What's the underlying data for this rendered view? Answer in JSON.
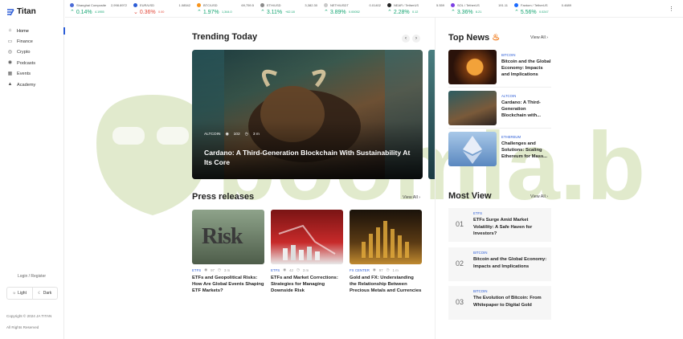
{
  "app": {
    "name": "Titan"
  },
  "sidebar": {
    "items": [
      {
        "label": "Home",
        "icon": "home-icon"
      },
      {
        "label": "Finance",
        "icon": "finance-icon"
      },
      {
        "label": "Crypto",
        "icon": "crypto-icon"
      },
      {
        "label": "Podcasts",
        "icon": "podcast-icon"
      },
      {
        "label": "Events",
        "icon": "calendar-icon"
      },
      {
        "label": "Academy",
        "icon": "academy-icon"
      }
    ],
    "login_label": "Login / Register",
    "theme": {
      "light": "Light",
      "dark": "Dark"
    },
    "copyright": "Copyright © 2024 JA TITAN",
    "rights": "All Rights Reserved"
  },
  "ticker": [
    {
      "name": "Shanghai Composite",
      "price": "2,998.8972",
      "pct": "0.14%",
      "chg": "4.1955",
      "dir": "up",
      "color": "#4b6bd6"
    },
    {
      "name": "EUR/USD",
      "price": "1.08542",
      "pct": "0.36%",
      "chg": "0.00",
      "dir": "down",
      "color": "#2b5cd6"
    },
    {
      "name": "BTC/USD",
      "price": "69,759.5",
      "pct": "1.97%",
      "chg": "1,344.0",
      "dir": "up",
      "color": "#f7931a"
    },
    {
      "name": "ETH/USD",
      "price": "3,382.30",
      "pct": "3.11%",
      "chg": "+62.18",
      "dir": "up",
      "color": "#8a8a8a"
    },
    {
      "name": "NETH/USDT",
      "price": "0.01402",
      "pct": "3.89%",
      "chg": "0.00052",
      "dir": "up",
      "color": "#c9c9c9"
    },
    {
      "name": "NEAR / TetherUS",
      "price": "5.559",
      "pct": "2.28%",
      "chg": "0.12",
      "dir": "up",
      "color": "#222"
    },
    {
      "name": "SOL / TetherUS",
      "price": "191.11",
      "pct": "3.36%",
      "chg": "6.21",
      "dir": "up",
      "color": "#7b3fe4"
    },
    {
      "name": "Fantom / TetherUS",
      "price": "0.4689",
      "pct": "5.56%",
      "chg": "0.0247",
      "dir": "up",
      "color": "#1969ff"
    }
  ],
  "trending": {
    "title": "Trending Today",
    "prev_icon": "chevron-left-icon",
    "next_icon": "chevron-right-icon",
    "hero": {
      "category": "ALTCOIN",
      "views": "102",
      "read_time": "3 m",
      "title": "Cardano: A Third-Generation Blockchain With Sustainability At Its Core"
    }
  },
  "press": {
    "title": "Press releases",
    "view_all": "View All",
    "items": [
      {
        "category": "ETFS",
        "views": "97",
        "read_time": "3 m",
        "title": "ETFs and Geopolitical Risks: How Are Global Events Shaping ETF Markets?",
        "thumb_text": "Risk"
      },
      {
        "category": "ETFS",
        "views": "42",
        "read_time": "3 m",
        "title": "ETFs and Market Corrections: Strategies for Managing Downside Risk"
      },
      {
        "category": "FX CENTER",
        "views": "97",
        "read_time": "1 m",
        "title": "Gold and FX: Understanding the Relationship Between Precious Metals and Currencies"
      }
    ]
  },
  "top_news": {
    "title": "Top News",
    "view_all": "View All",
    "items": [
      {
        "category": "BITCOIN",
        "title": "Bitcoin and the Global Economy: Impacts and Implications"
      },
      {
        "category": "ALTCOIN",
        "title": "Cardano: A Third-Generation Blockchain with..."
      },
      {
        "category": "ETHEREUM",
        "title": "Challenges and Solutions: Scaling Ethereum for Mass..."
      }
    ]
  },
  "most_view": {
    "title": "Most View",
    "view_all": "View All",
    "items": [
      {
        "num": "01",
        "category": "ETFS",
        "title": "ETFs Surge Amid Market Volatility: A Safe Haven for Investors?"
      },
      {
        "num": "02",
        "category": "BITCOIN",
        "title": "Bitcoin and the Global Economy: Impacts and Implications"
      },
      {
        "num": "03",
        "category": "BITCOIN",
        "title": "The Evolution of Bitcoin: From Whitepaper to Digital Gold"
      }
    ]
  },
  "watermark": {
    "text": "boomla.bid"
  }
}
